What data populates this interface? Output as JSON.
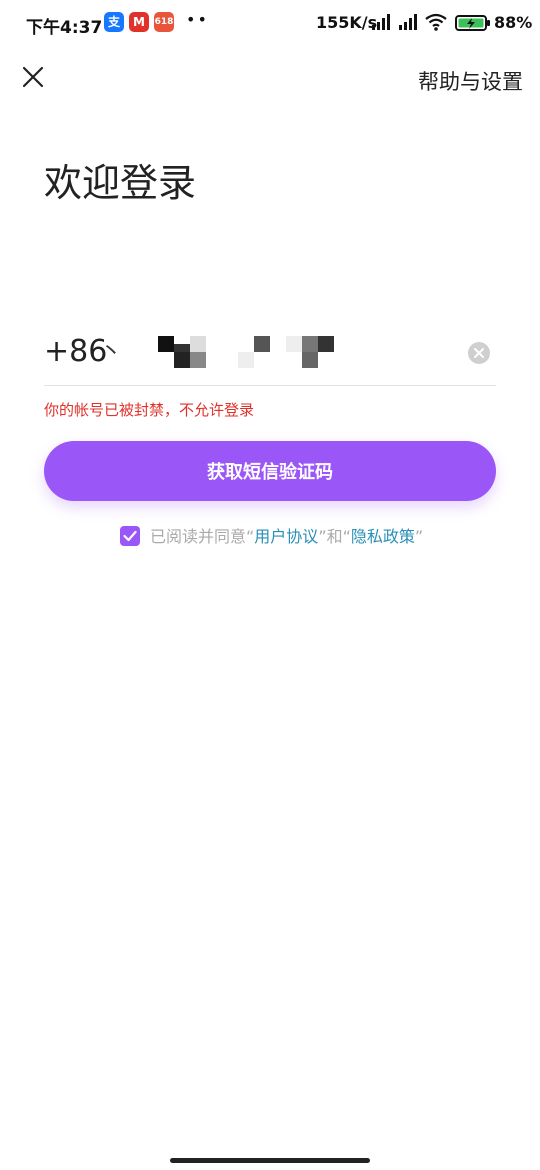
{
  "status_bar": {
    "time": "下午4:37",
    "app_icons": [
      {
        "name": "alipay-icon",
        "glyph": "支",
        "color": "#1677ff"
      },
      {
        "name": "metro-icon",
        "glyph": "M",
        "color": "#e0322b"
      },
      {
        "name": "sale-618-icon",
        "glyph": "618",
        "color": "#e8553a"
      }
    ],
    "more": "••",
    "net_speed": "155K/s",
    "battery_pct": "88%"
  },
  "topbar": {
    "close_icon": "close-icon",
    "help_label": "帮助与设置"
  },
  "title": "欢迎登录",
  "phone": {
    "prefix": "+86",
    "separator": "丶"
  },
  "error_message": "你的帐号已被封禁，不允许登录",
  "cta_label": "获取短信验证码",
  "agreement": {
    "checked": true,
    "pre": "已阅读并同意“",
    "user_agreement": "用户协议",
    "mid": "”和“",
    "privacy_policy": "隐私政策",
    "post": "”"
  },
  "colors": {
    "accent": "#9b56f7",
    "error": "#e0322b",
    "link": "#2a8fb8"
  }
}
